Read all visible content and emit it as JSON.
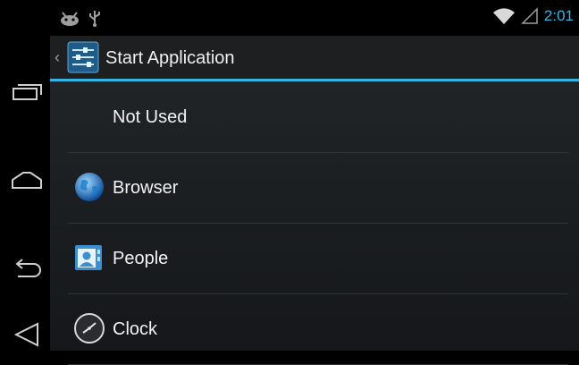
{
  "status_bar": {
    "time": "2:01"
  },
  "action_bar": {
    "title": "Start Application"
  },
  "list": {
    "items": [
      {
        "label": "Not Used",
        "icon": "none"
      },
      {
        "label": "Browser",
        "icon": "globe-icon"
      },
      {
        "label": "People",
        "icon": "contact-card-icon"
      },
      {
        "label": "Clock",
        "icon": "clock-icon"
      }
    ]
  },
  "colors": {
    "accent": "#33b5e5",
    "background": "#000000",
    "list_bg": "#212427"
  }
}
